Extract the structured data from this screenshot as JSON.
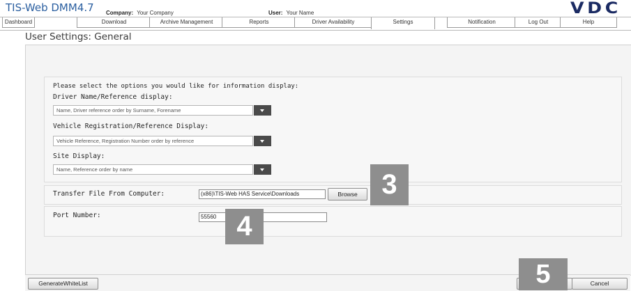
{
  "header": {
    "app_title": "TIS-Web DMM4.7",
    "company_key": "Company:",
    "company_value": "Your Company",
    "user_key": "User:",
    "user_value": "Your Name",
    "logo_text": "VDC"
  },
  "nav": {
    "tabs": [
      {
        "label": "Dashboard"
      },
      {
        "label": "Download"
      },
      {
        "label": "Archive Management"
      },
      {
        "label": "Reports"
      },
      {
        "label": "Driver Availability"
      },
      {
        "label": "Settings",
        "active": true
      },
      {
        "label": "Notification"
      },
      {
        "label": "Log Out"
      },
      {
        "label": "Help"
      }
    ]
  },
  "page": {
    "title": "User Settings: General"
  },
  "display_options": {
    "intro": "Please select the options you would like for information display:",
    "driver_label": "Driver Name/Reference display:",
    "driver_value": "Name, Driver reference order by  Surname, Forename",
    "vehicle_label": "Vehicle Registration/Reference Display:",
    "vehicle_value": "Vehicle Reference, Registration Number order by reference",
    "site_label": "Site Display:",
    "site_value": "Name, Reference order by name"
  },
  "transfer": {
    "label": "Transfer File From Computer:",
    "path_value": "(x86)\\TIS-Web HAS Service\\Downloads",
    "browse_label": "Browse"
  },
  "port": {
    "label": "Port Number:",
    "value": "55560"
  },
  "callouts": {
    "c3": "3",
    "c4": "4",
    "c5": "5"
  },
  "footer": {
    "whitelist_label": "GenerateWhiteList",
    "cancel_label": "Cancel"
  },
  "colors": {
    "title_blue": "#2b5fa0",
    "logo_navy": "#1b2b63",
    "callout_gray": "#8e8e8e"
  }
}
